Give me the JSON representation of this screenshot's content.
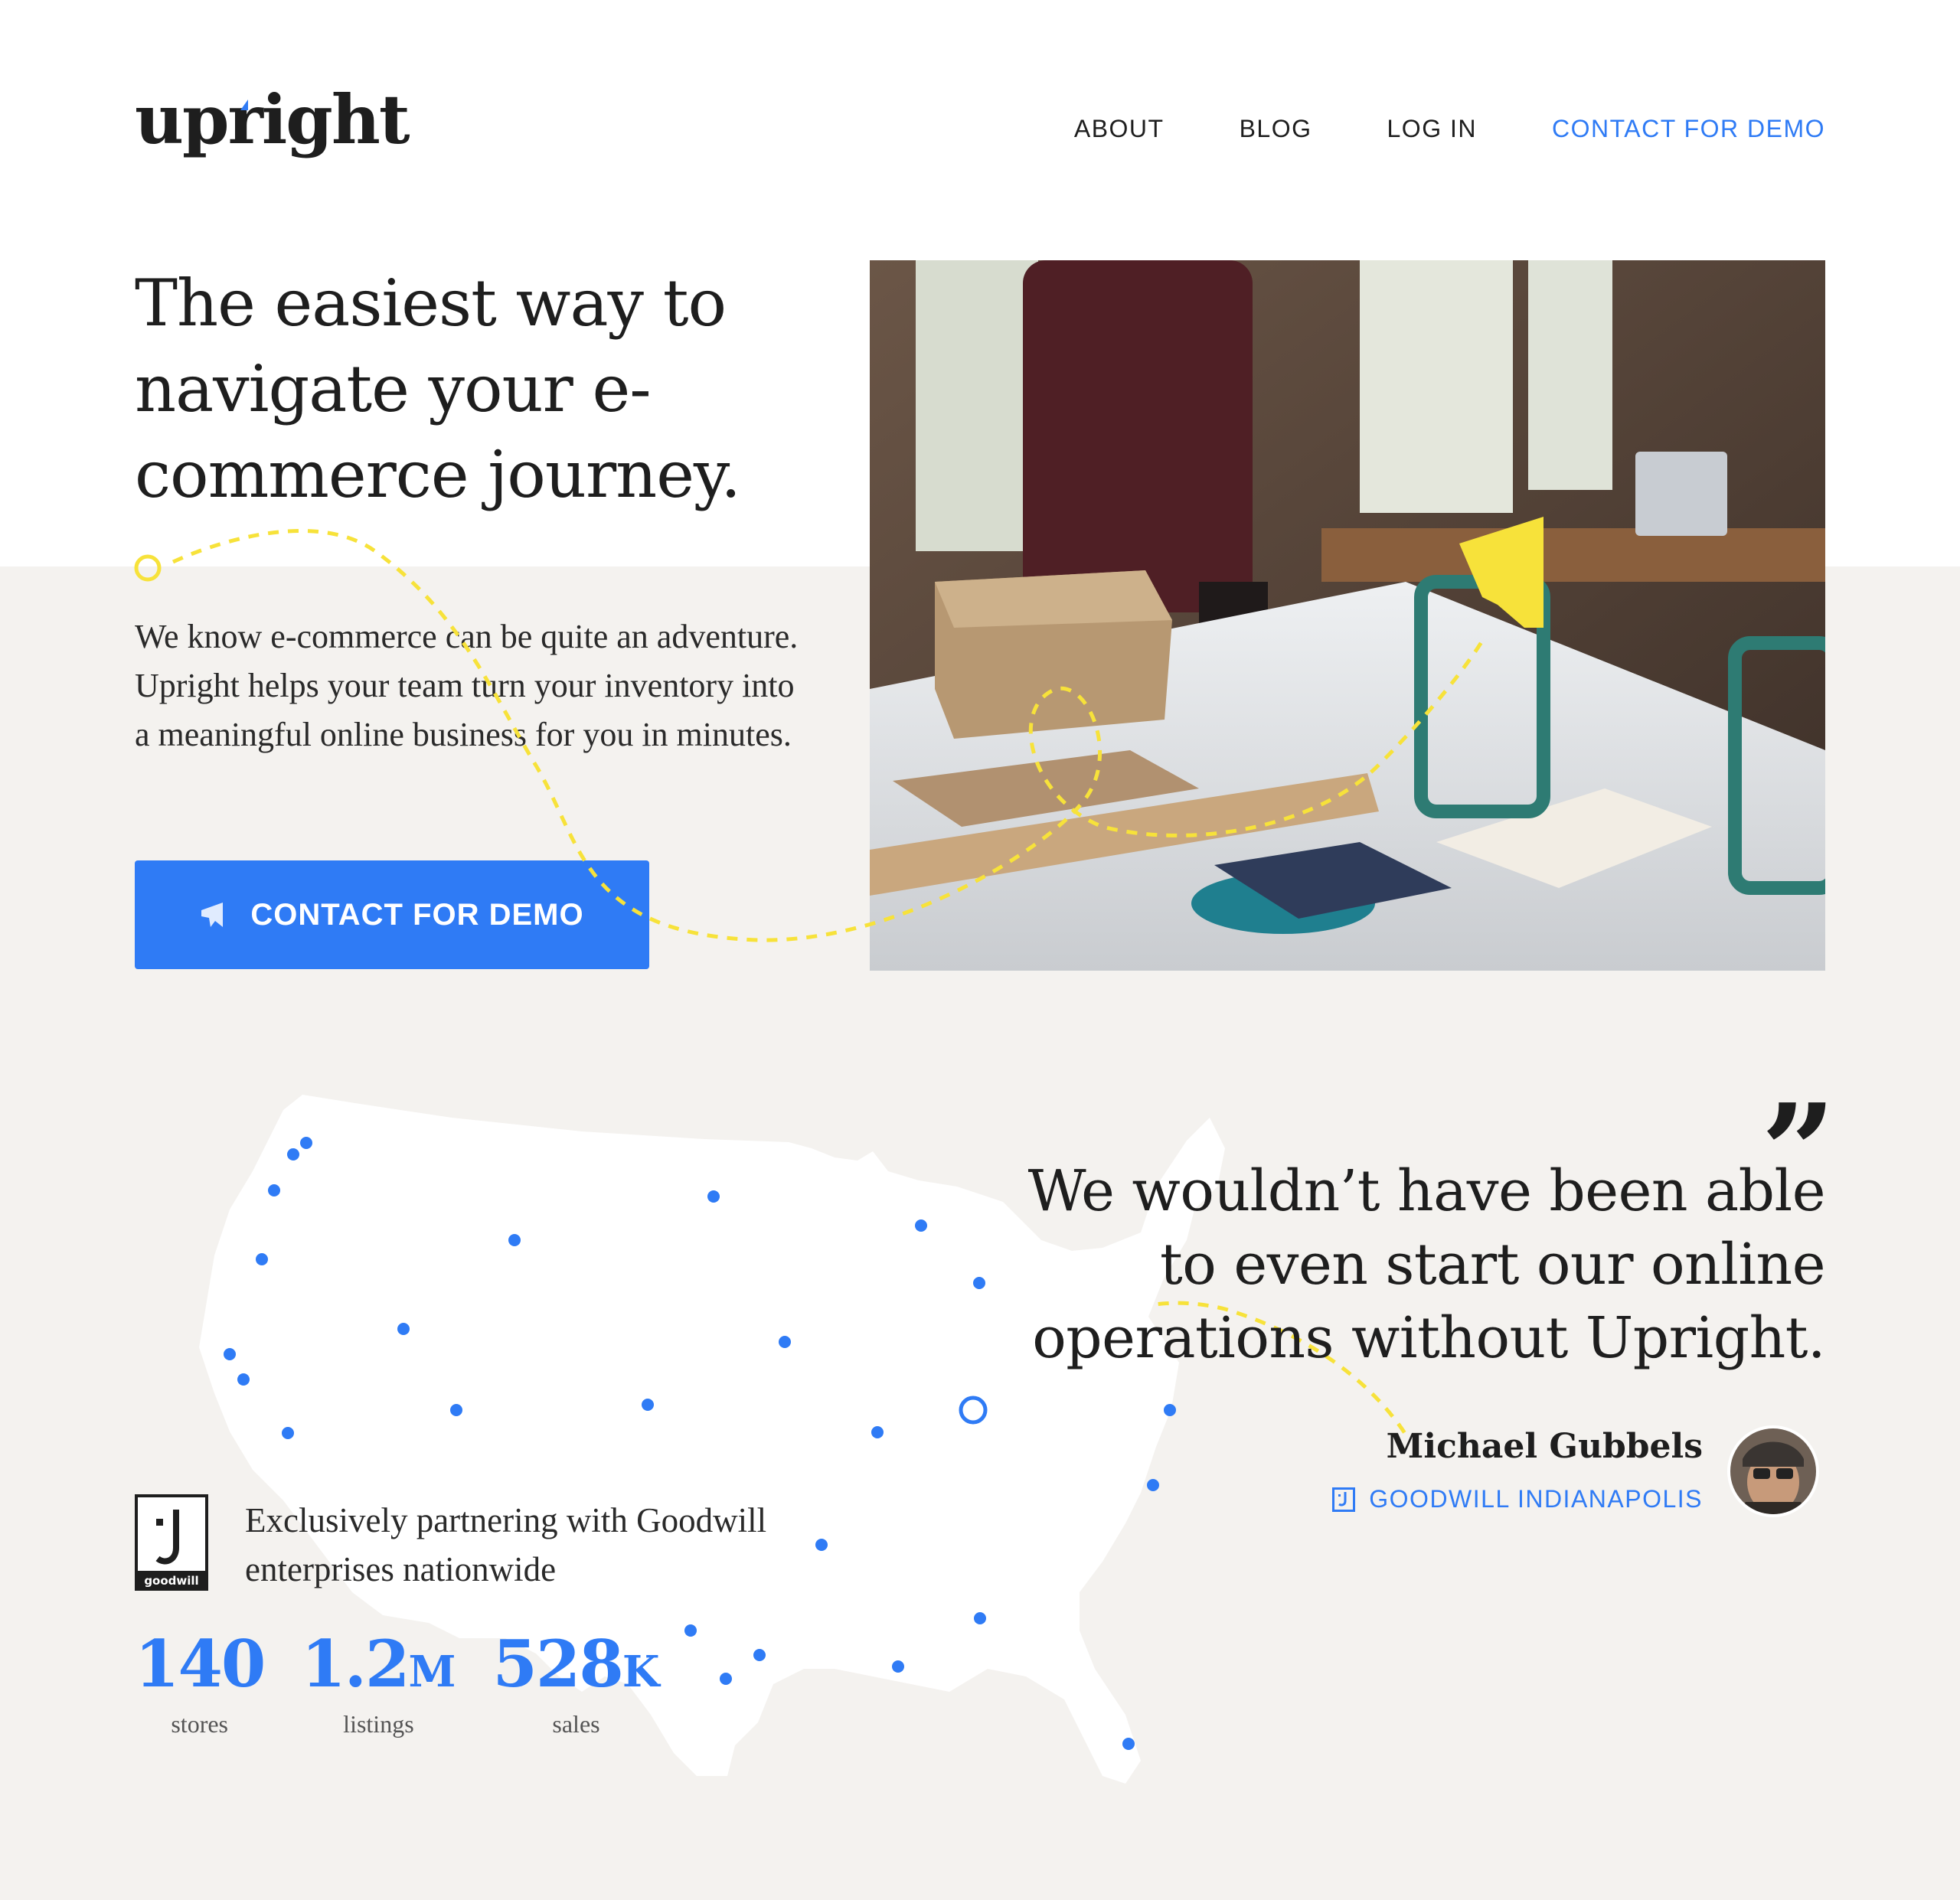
{
  "brand": {
    "logo_text": "upright"
  },
  "nav": {
    "items": [
      {
        "label": "ABOUT"
      },
      {
        "label": "BLOG"
      },
      {
        "label": "LOG IN"
      },
      {
        "label": "CONTACT FOR DEMO"
      }
    ]
  },
  "hero": {
    "title": "The easiest way to navigate your e-commerce journey.",
    "body": "We know e-commerce can be quite an adventure. Upright helps your team turn your inventory into a meaningful online business for you in minutes.",
    "cta_label": "CONTACT FOR DEMO",
    "cta_icon": "megaphone-icon"
  },
  "partner": {
    "logo_name": "goodwill-logo",
    "logo_text": "goodwill",
    "text": "Exclusively partnering with Goodwill enterprises nationwide"
  },
  "stats": [
    {
      "value": "140",
      "unit": "",
      "label": "stores"
    },
    {
      "value": "1.2",
      "unit": "M",
      "label": "listings"
    },
    {
      "value": "528",
      "unit": "K",
      "label": "sales"
    }
  ],
  "testimonial": {
    "quote_mark": "”",
    "quote": "We wouldn’t have been able to even start our online operations without Upright.",
    "author_name": "Michael Gubbels",
    "author_org": "GOODWILL INDIANAPOLIS",
    "org_icon": "goodwill-icon"
  },
  "colors": {
    "accent": "#2f7bf5",
    "highlight": "#f7e23a",
    "band": "#f4f2ef",
    "text": "#1e1e1e"
  }
}
